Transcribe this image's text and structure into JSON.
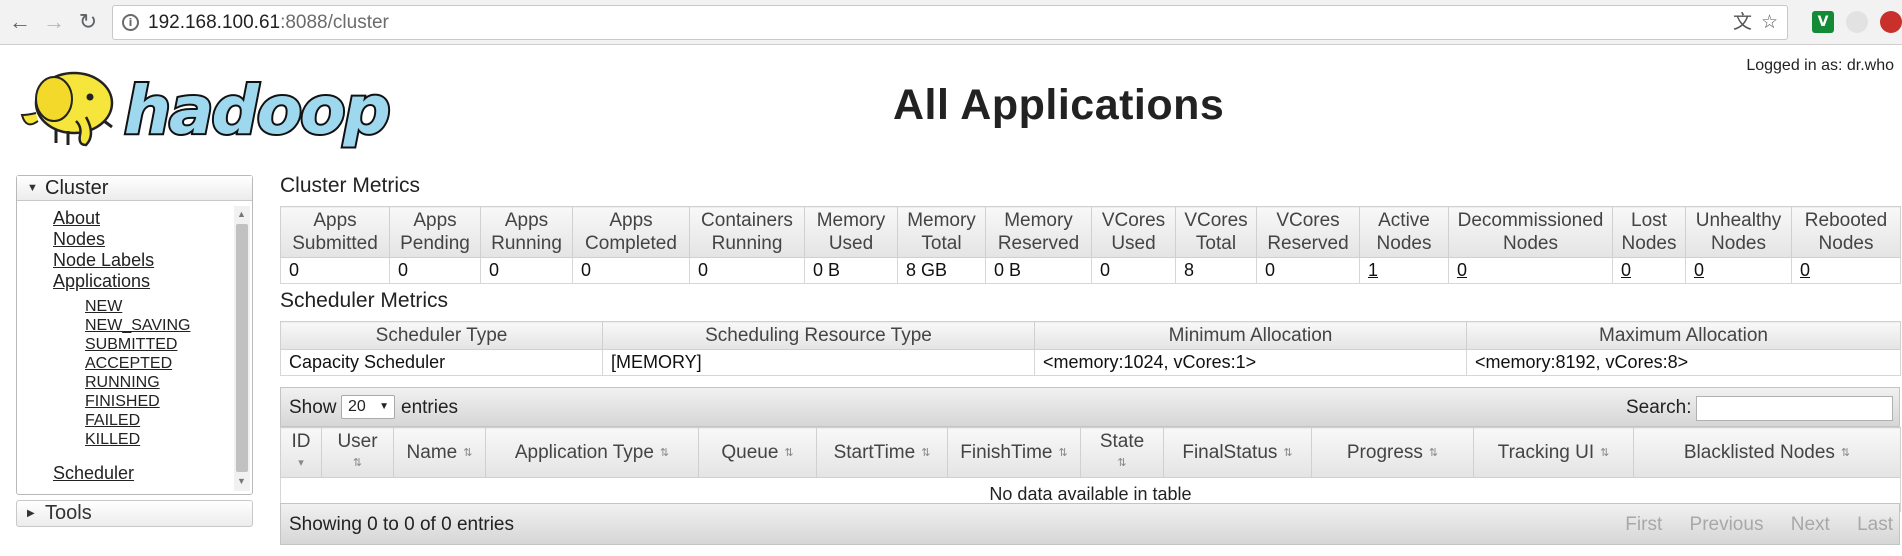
{
  "browser": {
    "url_host": "192.168.100.61",
    "url_rest": ":8088/cluster",
    "ext_green_label": "V"
  },
  "header": {
    "logged_in": "Logged in as: dr.who",
    "title": "All Applications"
  },
  "sidebar": {
    "cluster_label": "Cluster",
    "links": [
      "About",
      "Nodes",
      "Node Labels",
      "Applications"
    ],
    "app_states": [
      "NEW",
      "NEW_SAVING",
      "SUBMITTED",
      "ACCEPTED",
      "RUNNING",
      "FINISHED",
      "FAILED",
      "KILLED"
    ],
    "scheduler": "Scheduler",
    "tools_label": "Tools"
  },
  "cluster_metrics": {
    "title": "Cluster Metrics",
    "headers": [
      [
        "Apps",
        "Submitted"
      ],
      [
        "Apps",
        "Pending"
      ],
      [
        "Apps",
        "Running"
      ],
      [
        "Apps",
        "Completed"
      ],
      [
        "Containers",
        "Running"
      ],
      [
        "Memory",
        "Used"
      ],
      [
        "Memory",
        "Total"
      ],
      [
        "Memory",
        "Reserved"
      ],
      [
        "VCores",
        "Used"
      ],
      [
        "VCores",
        "Total"
      ],
      [
        "VCores",
        "Reserved"
      ],
      [
        "Active",
        "Nodes"
      ],
      [
        "Decommissioned",
        "Nodes"
      ],
      [
        "Lost",
        "Nodes"
      ],
      [
        "Unhealthy",
        "Nodes"
      ],
      [
        "Rebooted",
        "Nodes"
      ]
    ],
    "values": [
      "0",
      "0",
      "0",
      "0",
      "0",
      "0 B",
      "8 GB",
      "0 B",
      "0",
      "8",
      "0",
      "1",
      "0",
      "0",
      "0",
      "0"
    ]
  },
  "scheduler_metrics": {
    "title": "Scheduler Metrics",
    "headers": [
      "Scheduler Type",
      "Scheduling Resource Type",
      "Minimum Allocation",
      "Maximum Allocation"
    ],
    "values": [
      "Capacity Scheduler",
      "[MEMORY]",
      "<memory:1024, vCores:1>",
      "<memory:8192, vCores:8>"
    ]
  },
  "apps_table": {
    "show_label": "Show",
    "page_size": "20",
    "entries_label": "entries",
    "search_label": "Search:",
    "columns": [
      [
        "ID"
      ],
      [
        "User"
      ],
      [
        "Name"
      ],
      [
        "Application Type"
      ],
      [
        "Queue"
      ],
      [
        "StartTime"
      ],
      [
        "FinishTime"
      ],
      [
        "State"
      ],
      [
        "FinalStatus"
      ],
      [
        "Progress"
      ],
      [
        "Tracking UI"
      ],
      [
        "Blacklisted Nodes"
      ]
    ],
    "empty_message": "No data available in table",
    "info": "Showing 0 to 0 of 0 entries",
    "pager": [
      "First",
      "Previous",
      "Next",
      "Last"
    ]
  }
}
